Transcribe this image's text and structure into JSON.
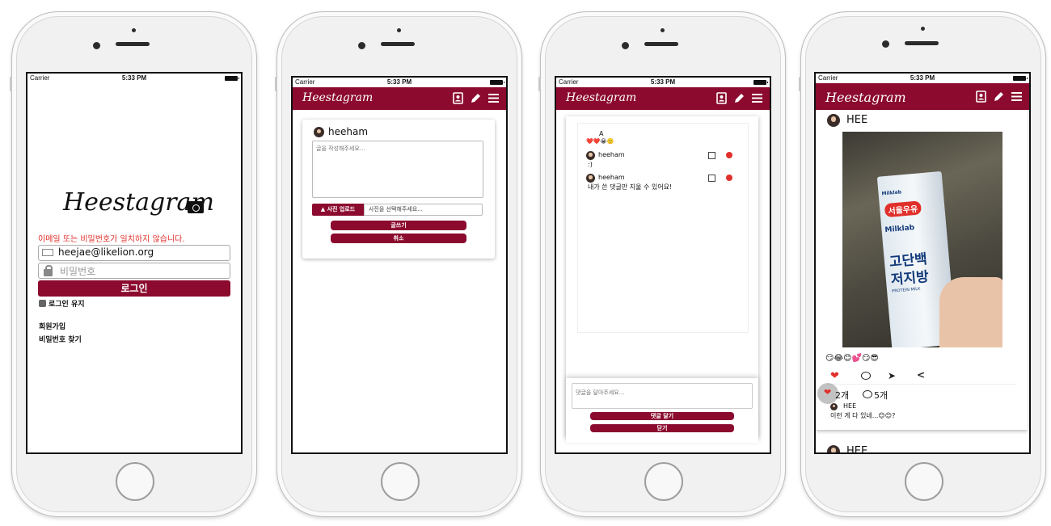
{
  "status_bar": {
    "carrier": "Carrier",
    "time": "5:33 PM"
  },
  "brand": {
    "logo": "Heestagram",
    "nav_logo": "Heestagram"
  },
  "login": {
    "error_message": "이메일 또는 비밀번호가 일치하지 않습니다.",
    "email_value": "heejae@likelion.org",
    "password_placeholder": "비밀번호",
    "login_button": "로그인",
    "remember_label": "로그인 유지",
    "signup_link": "회원가입",
    "find_password_link": "비밀번호 찾기"
  },
  "write": {
    "username": "heeham",
    "textarea_placeholder": "글을 작성해주세요...",
    "upload_button": "사진 업로드",
    "upload_placeholder": "사진을 선택해주세요...",
    "submit_button": "글쓰기",
    "cancel_button": "취소"
  },
  "comments": {
    "post_text": "A",
    "post_emojis": "❤️❤️😭🙂",
    "items": [
      {
        "user": "heeham",
        "text": ":)"
      },
      {
        "user": "heeham",
        "text": "내가 쓴 댓글만 지울 수 있어요!"
      }
    ],
    "input_placeholder": "댓글을 달아주세요...",
    "submit_button": "댓글 달기",
    "close_button": "닫기"
  },
  "feed": {
    "username": "HEE",
    "photo": {
      "brand_small": "Milklab",
      "brand_red": "서울우유",
      "brand_product": "Milklab",
      "big_text_1": "고단백",
      "big_text_2": "저지방",
      "sub_text": "PROTEIN MILK"
    },
    "emoji_row": "😏😂😊💕😏😎",
    "likes": "2개",
    "comments_count": "5개",
    "comment_user": "HEE",
    "comment_text": "이런 게 다 있네...😊😊?",
    "next_user": "HEE"
  },
  "colors": {
    "brand": "#8b0a2e",
    "error": "#e0302b"
  }
}
